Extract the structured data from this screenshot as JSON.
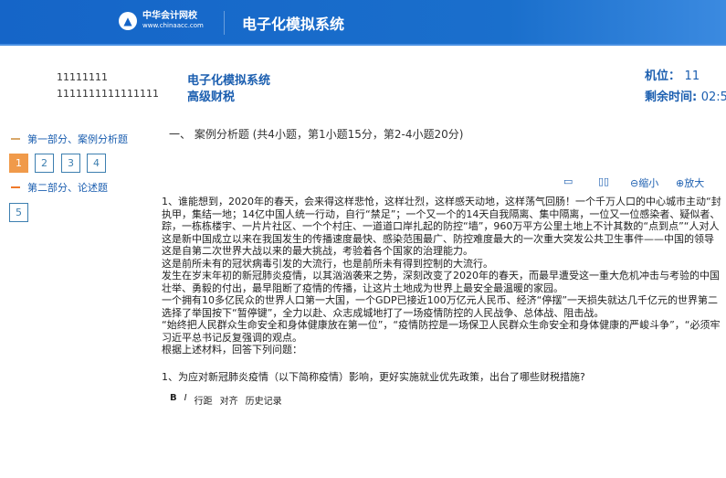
{
  "header": {
    "logo_cn": "中华会计网校",
    "logo_url": "www.chinaacc.com",
    "title": "电子化模拟系统"
  },
  "info": {
    "user_id_1": "11111111",
    "user_id_2": "1111111111111111",
    "system_name": "电子化模拟系统",
    "subject": "高级财税",
    "seat_label": "机位：",
    "seat_value": "11",
    "time_label": "剩余时间:",
    "time_value": "02:5"
  },
  "sidebar": {
    "sections": [
      {
        "label": "第一部分、案例分析题",
        "questions": [
          "1",
          "2",
          "3",
          "4"
        ],
        "active": "1"
      },
      {
        "label": "第二部分、论述题",
        "questions": [
          "5"
        ]
      }
    ]
  },
  "main": {
    "part_title": "一、 案例分析题 (共4小题，第1小题15分，第2-4小题20分)",
    "tools": {
      "shrink": "缩小",
      "enlarge": "放大"
    },
    "paragraph": [
      "1、谁能想到，2020年的春天，会来得这样悲怆，这样壮烈，这样感天动地，这样荡气回肠！一个千万人口的中心城市主动“封",
      "执甲，集结一地；14亿中国人统一行动，自行“禁足”；一个又一个的14天自我隔离、集中隔离，一位又一位感染者、疑似者、",
      "踪，一栋栋楼宇、一片片社区、一个个村庄、一道道口岸扎起的防控“墙”，960万平方公里土地上不计其数的“点到点”“人对人",
      "这是新中国成立以来在我国发生的传播速度最快、感染范围最广、防控难度最大的一次重大突发公共卫生事件——中国的领导",
      "这是自第二次世界大战以来的最大挑战，考验着各个国家的治理能力。",
      "这是前所未有的冠状病毒引发的大流行，也是前所未有得到控制的大流行。",
      "发生在岁末年初的新冠肺炎疫情，以其汹汹袭来之势，深刻改变了2020年的春天，而最早遭受这一重大危机冲击与考验的中国",
      "壮举、勇毅的付出，最早阻断了疫情的传播，让这片土地成为世界上最安全最温暖的家园。",
      "一个拥有10多亿民众的世界人口第一大国，一个GDP已接近100万亿元人民币、经济“停摆”一天损失就达几千亿元的世界第二",
      "选择了举国按下“暂停键”，全力以赴、众志成城地打了一场疫情防控的人民战争、总体战、阻击战。",
      "“始终把人民群众生命安全和身体健康放在第一位”，“疫情防控是一场保卫人民群众生命安全和身体健康的严峻斗争”，“必须牢",
      "习近平总书记反复强调的观点。",
      "根据上述材料，回答下列问题："
    ],
    "question": "1、为应对新冠肺炎疫情（以下简称疫情）影响，更好实施就业优先政策，出台了哪些财税措施?",
    "editor": {
      "bold": "B",
      "italic": "I",
      "line_spacing": "行距",
      "align": "对齐",
      "history": "历史记录"
    }
  },
  "colors": {
    "header": "#1565c8",
    "accent": "#1c5fb0",
    "active": "#f09a4a"
  }
}
